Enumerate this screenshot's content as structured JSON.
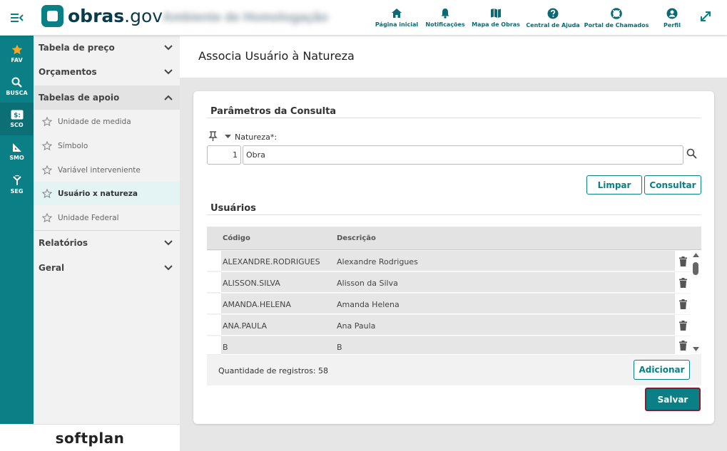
{
  "header": {
    "brand": "obras",
    "brand_suffix": ".gov",
    "environment": "Ambiente de Homologação",
    "nav": [
      {
        "label": "Página inicial",
        "icon": "home-icon"
      },
      {
        "label": "Notificações",
        "icon": "bell-icon"
      },
      {
        "label": "Mapa de Obras",
        "icon": "map-icon"
      },
      {
        "label": "Central de Ajuda",
        "icon": "help-icon"
      },
      {
        "label": "Portal de Chamados",
        "icon": "lifebuoy-icon"
      },
      {
        "label": "Perfil",
        "icon": "user-icon"
      }
    ]
  },
  "rail": [
    {
      "label": "FAV",
      "icon": "star-icon"
    },
    {
      "label": "BUSCA",
      "icon": "search-icon"
    },
    {
      "label": "SCO",
      "icon": "sco-icon"
    },
    {
      "label": "SMO",
      "icon": "ruler-icon"
    },
    {
      "label": "SEG",
      "icon": "fork-icon"
    }
  ],
  "sidebar": {
    "sections": [
      {
        "label": "Tabela de preço"
      },
      {
        "label": "Orçamentos"
      },
      {
        "label": "Tabelas de apoio"
      },
      {
        "label": "Relatórios"
      },
      {
        "label": "Geral"
      }
    ],
    "subitems": [
      {
        "label": "Unidade de medida"
      },
      {
        "label": "Símbolo"
      },
      {
        "label": "Variável interveniente"
      },
      {
        "label": "Usuário x natureza"
      },
      {
        "label": "Unidade Federal"
      }
    ]
  },
  "footer": {
    "logo": "softplan"
  },
  "page": {
    "title": "Associa Usuário à Natureza"
  },
  "params": {
    "title": "Parâmetros da Consulta",
    "natureza_label": "Natureza*:",
    "natureza_code": "1",
    "natureza_name": "Obra",
    "clear_label": "Limpar",
    "query_label": "Consultar"
  },
  "users": {
    "title": "Usuários",
    "columns": {
      "code": "Código",
      "description": "Descrição"
    },
    "rows": [
      {
        "code": "ALEXANDRE.RODRIGUES",
        "description": "Alexandre Rodrigues"
      },
      {
        "code": "ALISSON.SILVA",
        "description": "Alisson da Silva"
      },
      {
        "code": "AMANDA.HELENA",
        "description": "Amanda Helena"
      },
      {
        "code": "ANA.PAULA",
        "description": "Ana Paula"
      },
      {
        "code": "B",
        "description": "B"
      }
    ],
    "count_label": "Quantidade de registros: 58",
    "add_label": "Adicionar"
  },
  "actions": {
    "save_label": "Salvar"
  },
  "colors": {
    "primary": "#0a7f86",
    "save_border": "#8b1a2b"
  }
}
